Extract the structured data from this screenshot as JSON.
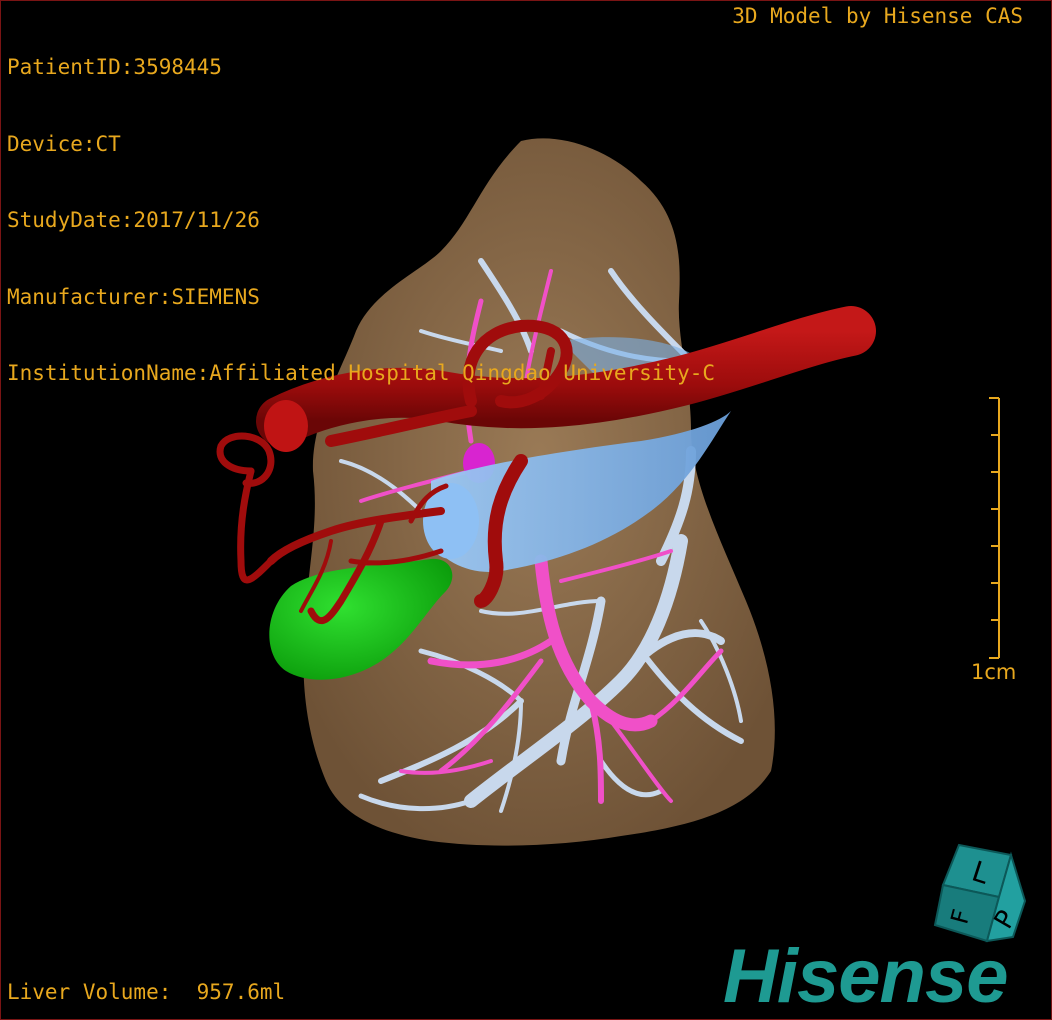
{
  "info": {
    "patient_id": "PatientID:3598445",
    "device": "Device:CT",
    "study_date": "StudyDate:2017/11/26",
    "manufacturer": "Manufacturer:SIEMENS",
    "institution": "InstitutionName:Affiliated Hospital Qingdao University-C"
  },
  "vendor_label": "3D Model by Hisense CAS",
  "liver_volume": "Liver Volume:  957.6ml",
  "scale_label": "1cm",
  "orientation_cube": {
    "faces": [
      "L",
      "P",
      "F"
    ],
    "color": "#1e8a8a"
  },
  "logo_text": "Hisense",
  "colors": {
    "overlay_text": "#e8a81e",
    "liver": "#8a6a4a",
    "artery": "#a00c0c",
    "portal_vein": "#f050c8",
    "hepatic_vein": "#c8d8ec",
    "vena_cava": "#7ab0e8",
    "gallbladder": "#1cc41c",
    "logo": "#1e9a92"
  }
}
